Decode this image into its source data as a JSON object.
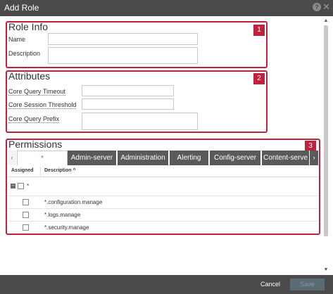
{
  "window": {
    "title": "Add Role",
    "help_icon": "?"
  },
  "role_info": {
    "title": "Role Info",
    "badge": "1",
    "name_label": "Name",
    "name_value": "",
    "description_label": "Description",
    "description_value": ""
  },
  "attributes": {
    "title": "Attributes",
    "badge": "2",
    "timeout_label": "Core Query Timeout",
    "threshold_label": "Core Session Threshold",
    "prefix_label": "Core Query Prefix"
  },
  "permissions": {
    "title": "Permissions",
    "badge": "3",
    "tabs": [
      "*",
      "Admin-server",
      "Administration",
      "Alerting",
      "Config-server",
      "Content-serve"
    ],
    "columns": {
      "assigned": "Assigned",
      "description": "Description ^"
    },
    "group_label": "*",
    "rows": [
      {
        "description": "*.configuration.manage"
      },
      {
        "description": "*.logs.manage"
      },
      {
        "description": "*.security.manage"
      }
    ]
  },
  "footer": {
    "cancel_label": "Cancel",
    "save_label": "Save"
  },
  "colors": {
    "highlight": "#c0223b",
    "titlebar": "#4a4a4a",
    "tab_dark": "#5a5a5a",
    "tab_active_text": "#4a7fbf"
  }
}
